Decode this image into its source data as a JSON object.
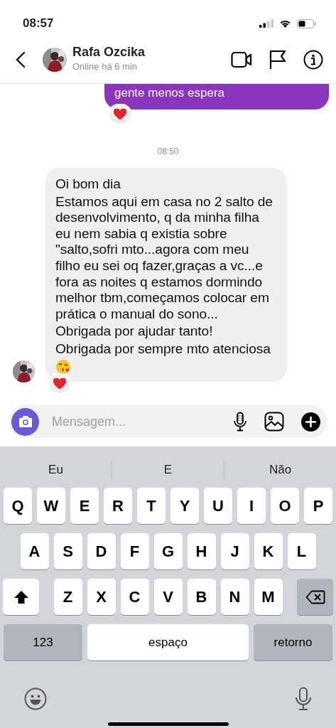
{
  "status_bar": {
    "time": "08:57"
  },
  "header": {
    "name": "Rafa Ozcika",
    "presence": "Online há 6 min"
  },
  "messages": [
    {
      "kind": "outgoing",
      "lines": [
        "gente menos espera"
      ],
      "reaction": true
    },
    {
      "kind": "timestamp",
      "text": "08:50"
    },
    {
      "kind": "incoming",
      "lines": [
        "Oi bom dia",
        "Estamos aqui em casa no 2 salto de desenvolvimento, q da minha filha eu nem sabia q existia sobre \"salto,sofri mto...agora com meu filho eu sei oq fazer,graças a vc...e fora as noites q estamos dormindo melhor tbm,começamos colocar em prática o manual do sono...",
        "Obrigada por ajudar tanto!",
        "Obrigada por sempre mto atenciosa"
      ],
      "reaction": true,
      "emoji_end": true
    }
  ],
  "composer": {
    "placeholder": "Mensagem..."
  },
  "keyboard": {
    "suggestions": [
      "Eu",
      "E",
      "Não"
    ],
    "rows": [
      [
        {
          "kind": "letter",
          "label": "Q"
        },
        {
          "kind": "letter",
          "label": "W"
        },
        {
          "kind": "letter",
          "label": "E"
        },
        {
          "kind": "letter",
          "label": "R"
        },
        {
          "kind": "letter",
          "label": "T"
        },
        {
          "kind": "letter",
          "label": "Y"
        },
        {
          "kind": "letter",
          "label": "U"
        },
        {
          "kind": "letter",
          "label": "I"
        },
        {
          "kind": "letter",
          "label": "O"
        },
        {
          "kind": "letter",
          "label": "P"
        }
      ],
      [
        {
          "kind": "letter",
          "label": "A"
        },
        {
          "kind": "letter",
          "label": "S"
        },
        {
          "kind": "letter",
          "label": "D"
        },
        {
          "kind": "letter",
          "label": "F"
        },
        {
          "kind": "letter",
          "label": "G"
        },
        {
          "kind": "letter",
          "label": "H"
        },
        {
          "kind": "letter",
          "label": "J"
        },
        {
          "kind": "letter",
          "label": "K"
        },
        {
          "kind": "letter",
          "label": "L"
        }
      ],
      [
        {
          "kind": "shift"
        },
        {
          "kind": "letter",
          "label": "Z"
        },
        {
          "kind": "letter",
          "label": "X"
        },
        {
          "kind": "letter",
          "label": "C"
        },
        {
          "kind": "letter",
          "label": "V"
        },
        {
          "kind": "letter",
          "label": "B"
        },
        {
          "kind": "letter",
          "label": "N"
        },
        {
          "kind": "letter",
          "label": "M"
        },
        {
          "kind": "delete"
        }
      ]
    ],
    "bottom_row": {
      "mode_key": "123",
      "space_key": "espaço",
      "return_key": "retorno"
    }
  }
}
